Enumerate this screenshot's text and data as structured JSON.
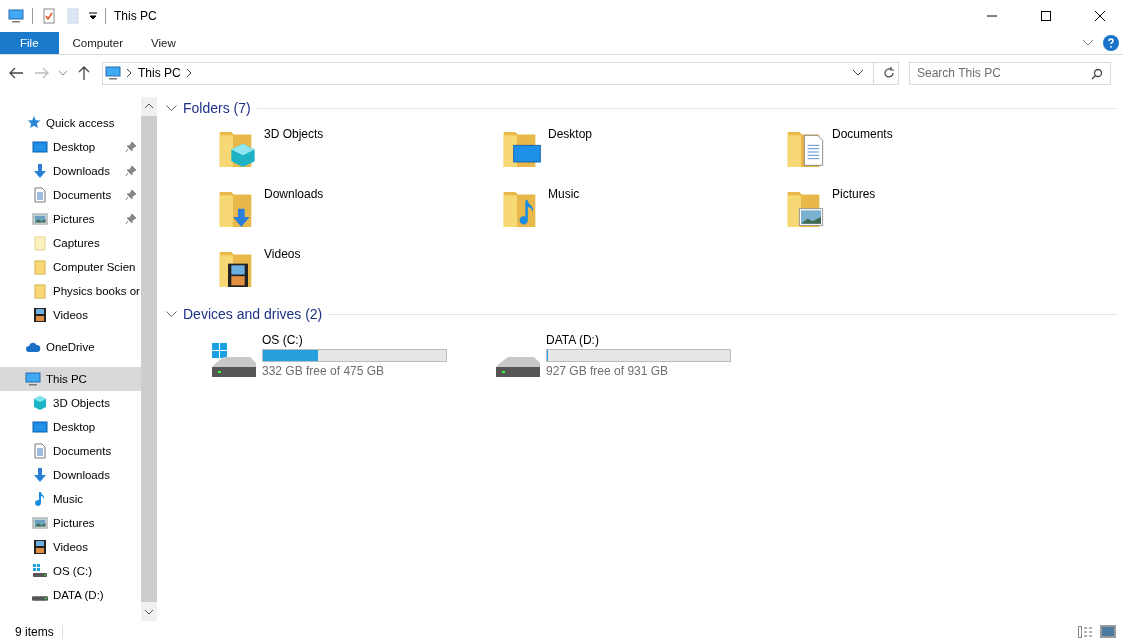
{
  "window": {
    "title": "This PC"
  },
  "ribbon_tabs": [
    {
      "label": "File",
      "kind": "file",
      "selected": false
    },
    {
      "label": "Computer",
      "kind": "tab",
      "selected": false
    },
    {
      "label": "View",
      "kind": "tab",
      "selected": false
    }
  ],
  "address": {
    "path": [
      "This PC"
    ]
  },
  "search": {
    "placeholder": "Search This PC"
  },
  "navigation": [
    {
      "label": "Quick access",
      "kind": "star",
      "selected": false,
      "children": [
        {
          "label": "Desktop",
          "kind": "desktop",
          "pinned": true,
          "selected": false
        },
        {
          "label": "Downloads",
          "kind": "downloads",
          "pinned": true,
          "selected": false
        },
        {
          "label": "Documents",
          "kind": "documents",
          "pinned": true,
          "selected": false
        },
        {
          "label": "Pictures",
          "kind": "pictures",
          "pinned": true,
          "selected": false
        },
        {
          "label": "Captures",
          "kind": "folder-pale",
          "pinned": false,
          "selected": false
        },
        {
          "label": "Computer Scien",
          "kind": "folder",
          "pinned": false,
          "selected": false
        },
        {
          "label": "Physics books or",
          "kind": "folder",
          "pinned": false,
          "selected": false
        },
        {
          "label": "Videos",
          "kind": "videos",
          "pinned": false,
          "selected": false
        }
      ]
    },
    {
      "label": "OneDrive",
      "kind": "cloud",
      "selected": false
    },
    {
      "label": "This PC",
      "kind": "pc",
      "selected": true,
      "children": [
        {
          "label": "3D Objects",
          "kind": "cube",
          "pinned": false,
          "selected": false
        },
        {
          "label": "Desktop",
          "kind": "desktop",
          "pinned": false,
          "selected": false
        },
        {
          "label": "Documents",
          "kind": "documents",
          "pinned": false,
          "selected": false
        },
        {
          "label": "Downloads",
          "kind": "downloads",
          "pinned": false,
          "selected": false
        },
        {
          "label": "Music",
          "kind": "music",
          "pinned": false,
          "selected": false
        },
        {
          "label": "Pictures",
          "kind": "pictures",
          "pinned": false,
          "selected": false
        },
        {
          "label": "Videos",
          "kind": "videos",
          "pinned": false,
          "selected": false
        },
        {
          "label": "OS (C:)",
          "kind": "drive-win",
          "pinned": false,
          "selected": false
        },
        {
          "label": "DATA (D:)",
          "kind": "drive",
          "pinned": false,
          "selected": false
        }
      ]
    }
  ],
  "groups": [
    {
      "title": "Folders (7)",
      "kind": "folders",
      "expanded": true,
      "items": [
        {
          "name": "3D Objects",
          "kind": "cube"
        },
        {
          "name": "Desktop",
          "kind": "desktop"
        },
        {
          "name": "Documents",
          "kind": "documents"
        },
        {
          "name": "Downloads",
          "kind": "downloads"
        },
        {
          "name": "Music",
          "kind": "music"
        },
        {
          "name": "Pictures",
          "kind": "pictures"
        },
        {
          "name": "Videos",
          "kind": "videos"
        }
      ]
    },
    {
      "title": "Devices and drives (2)",
      "kind": "drives",
      "expanded": true,
      "items": [
        {
          "name": "OS (C:)",
          "kind": "drive-win",
          "level": 0.3,
          "free": "332 GB free of 475 GB"
        },
        {
          "name": "DATA (D:)",
          "kind": "drive",
          "level": 0.004,
          "free": "927 GB free of 931 GB"
        }
      ]
    }
  ],
  "status_bar": {
    "text": "9 items"
  }
}
